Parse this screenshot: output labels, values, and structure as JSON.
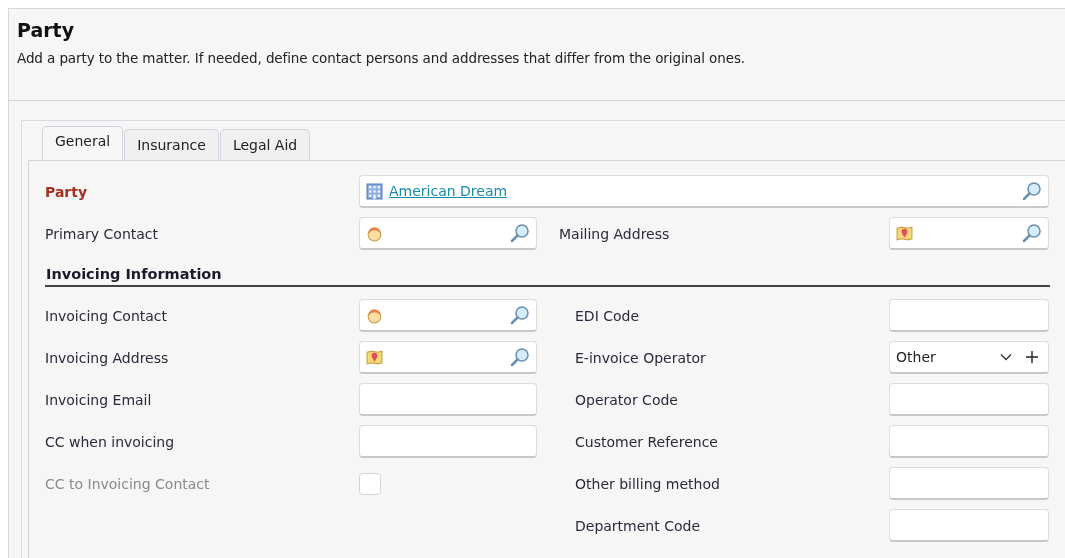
{
  "header": {
    "title": "Party",
    "description": "Add a party to the matter. If needed, define contact persons and addresses that differ from the original ones."
  },
  "tabs": [
    {
      "label": "General",
      "selected": true
    },
    {
      "label": "Insurance",
      "selected": false
    },
    {
      "label": "Legal Aid",
      "selected": false
    }
  ],
  "party": {
    "label": "Party",
    "required": true,
    "value": "American Dream"
  },
  "rows": [
    {
      "left": {
        "label": "Primary Contact",
        "kind": "contact"
      },
      "right": {
        "label": "Mailing Address",
        "kind": "address"
      }
    }
  ],
  "section": {
    "title": "Invoicing Information",
    "rows": [
      {
        "left": {
          "label": "Invoicing Contact",
          "kind": "contact"
        },
        "right": {
          "label": "EDI Code",
          "kind": "text"
        }
      },
      {
        "left": {
          "label": "Invoicing Address",
          "kind": "address"
        },
        "right": {
          "label": "E-invoice Operator",
          "kind": "select",
          "value": "Other"
        }
      },
      {
        "left": {
          "label": "Invoicing Email",
          "kind": "text"
        },
        "right": {
          "label": "Operator Code",
          "kind": "text"
        }
      },
      {
        "left": {
          "label": "CC when invoicing",
          "kind": "text"
        },
        "right": {
          "label": "Customer Reference",
          "kind": "text"
        }
      },
      {
        "left": {
          "label": "CC to Invoicing Contact",
          "kind": "checkbox",
          "checked": false,
          "disabled": true
        },
        "right": {
          "label": "Other billing method",
          "kind": "text"
        }
      },
      {
        "right": {
          "label": "Department Code",
          "kind": "text"
        }
      }
    ]
  }
}
